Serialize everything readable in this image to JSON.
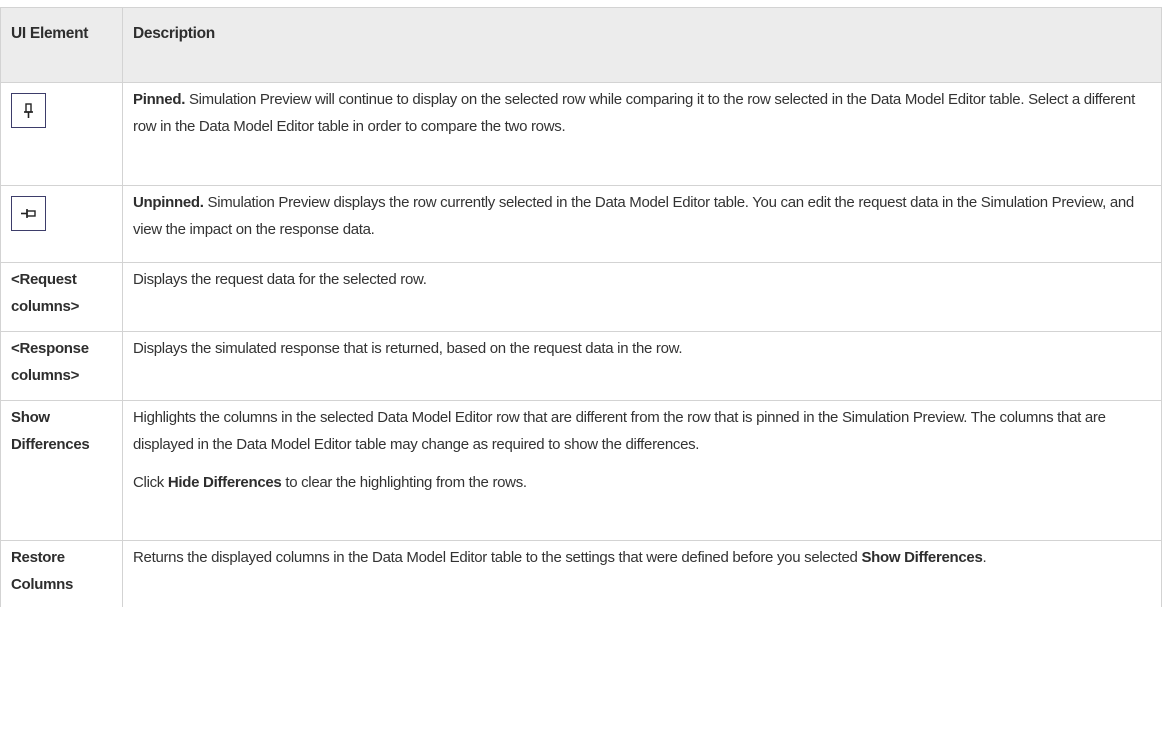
{
  "table": {
    "headers": {
      "element": "UI Element",
      "description": "Description"
    },
    "rows": [
      {
        "icon": "pin-pinned-icon",
        "term": "Pinned.",
        "text": " Simulation Preview will continue to display on the selected row while comparing it to the row selected in the Data Model Editor table. Select a different row in the Data Model Editor table in order to compare the two rows."
      },
      {
        "icon": "pin-unpinned-icon",
        "term": "Unpinned.",
        "text": " Simulation Preview displays the row currently selected in the Data Model Editor table. You can edit the request data in the Simulation Preview, and view the impact on the response data."
      },
      {
        "element": "<Request columns>",
        "description": "Displays the request data for the selected row."
      },
      {
        "element": "<Response columns>",
        "description": "Displays the simulated response that is returned, based on the request data in the row."
      },
      {
        "element": "Show Differences",
        "description": "Highlights the columns in the selected Data Model Editor row that are different from the row that is pinned in the Simulation Preview. The columns that are displayed in the Data Model Editor table may change as required to show the differences.",
        "note_before": "Click ",
        "note_bold": "Hide Differences",
        "note_after": " to clear the highlighting from the rows."
      },
      {
        "element": "Restore Columns",
        "description_before": "Returns the displayed columns in the Data Model Editor table to the settings that were defined before you selected ",
        "description_bold": "Show Differences",
        "description_after": "."
      }
    ]
  },
  "colors": {
    "header_bg": "#ececec",
    "border": "#d3d3d3",
    "icon_border": "#3d3d6a",
    "text": "#333333"
  }
}
